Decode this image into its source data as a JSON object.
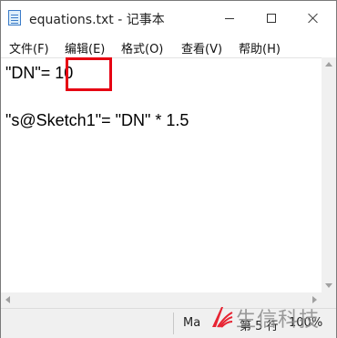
{
  "window": {
    "title": "equations.txt - 记事本"
  },
  "menu": [
    {
      "label": "文件(F)"
    },
    {
      "label": "编辑(E)"
    },
    {
      "label": "格式(O)"
    },
    {
      "label": "查看(V)"
    },
    {
      "label": "帮助(H)"
    }
  ],
  "editor": {
    "lines": [
      "\"DN\"= 10",
      "\"s@Sketch1\"= \"DN\" * 1.5"
    ],
    "highlight_color": "#e60012"
  },
  "status": {
    "mode": "Ma",
    "line_info": "第 5 行",
    "zoom": "100%"
  },
  "watermark": {
    "text": "生信科技",
    "logo_color": "#e60012"
  }
}
